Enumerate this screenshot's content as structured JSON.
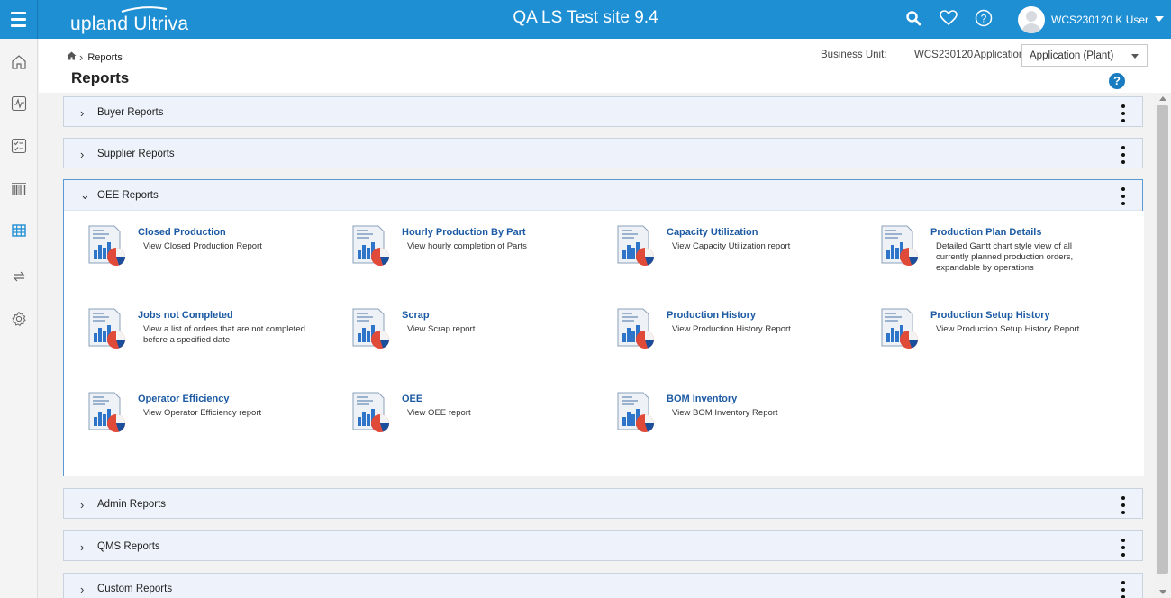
{
  "app": {
    "logo_text": "upland Ultriva",
    "site_title": "QA LS Test site 9.4",
    "user_name": "WCS230120 K User",
    "brand_color": "#1f8fd4"
  },
  "topbar_icons": [
    "search-icon",
    "heart-icon",
    "help-circle-icon",
    "avatar"
  ],
  "sidebar": {
    "items": [
      {
        "icon": "home-icon"
      },
      {
        "icon": "activity-chart-icon"
      },
      {
        "icon": "checklist-icon"
      },
      {
        "icon": "barcode-icon"
      },
      {
        "icon": "table-grid-icon",
        "active": true
      },
      {
        "icon": "exchange-icon"
      },
      {
        "icon": "settings-gear-icon"
      }
    ]
  },
  "header": {
    "breadcrumb": {
      "home_icon": "home-icon",
      "current": "Reports"
    },
    "page_title": "Reports",
    "business_unit_label": "Business Unit:",
    "business_unit_value": "WCS230120",
    "application_label": "Application:",
    "application_selected": "Application (Plant)",
    "help_icon": "question-circle-icon"
  },
  "sections": [
    {
      "title": "Buyer Reports",
      "expanded": false
    },
    {
      "title": "Supplier Reports",
      "expanded": false
    },
    {
      "title": "OEE Reports",
      "expanded": true
    },
    {
      "title": "Admin Reports",
      "expanded": false
    },
    {
      "title": "QMS Reports",
      "expanded": false
    },
    {
      "title": "Custom Reports",
      "expanded": false
    }
  ],
  "oee_reports": [
    {
      "name": "Closed Production",
      "desc": "View Closed Production Report"
    },
    {
      "name": "Hourly Production By Part",
      "desc": "View hourly completion of Parts"
    },
    {
      "name": "Capacity Utilization",
      "desc": "View Capacity Utilization report"
    },
    {
      "name": "Production Plan Details",
      "desc": "Detailed Gantt chart style view of all currently planned production orders, expandable by operations"
    },
    {
      "name": "Jobs not Completed",
      "desc": "View a list of orders that are not completed before a specified date"
    },
    {
      "name": "Scrap",
      "desc": "View Scrap report"
    },
    {
      "name": "Production History",
      "desc": "View Production History Report"
    },
    {
      "name": "Production Setup History",
      "desc": "View Production Setup History Report"
    },
    {
      "name": "Operator Efficiency",
      "desc": "View Operator Efficiency report"
    },
    {
      "name": "OEE",
      "desc": "View OEE report"
    },
    {
      "name": "BOM Inventory",
      "desc": "View BOM Inventory Report"
    }
  ]
}
